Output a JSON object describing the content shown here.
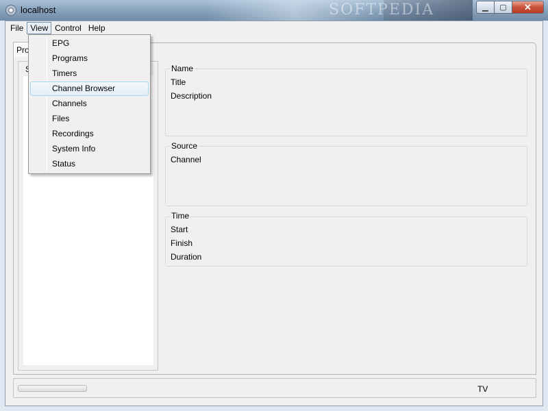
{
  "window": {
    "title": "localhost",
    "min_icon": "minimize-icon",
    "max_icon": "maximize-icon",
    "close_icon": "close-icon"
  },
  "menubar": {
    "items": [
      "File",
      "View",
      "Control",
      "Help"
    ]
  },
  "view_menu": {
    "items": [
      "EPG",
      "Programs",
      "Timers",
      "Channel Browser",
      "Channels",
      "Files",
      "Recordings",
      "System Info",
      "Status"
    ],
    "highlighted": "Channel Browser"
  },
  "tab": {
    "label": "Pro"
  },
  "left_group": {
    "label": "S"
  },
  "groups": {
    "name": {
      "title": "Name",
      "fields": [
        "Title",
        "Description"
      ]
    },
    "source": {
      "title": "Source",
      "fields": [
        "Channel"
      ]
    },
    "time": {
      "title": "Time",
      "fields": [
        "Start",
        "Finish",
        "Duration"
      ]
    }
  },
  "statusbar": {
    "mode": "TV"
  },
  "watermark": "SOFTPEDIA"
}
